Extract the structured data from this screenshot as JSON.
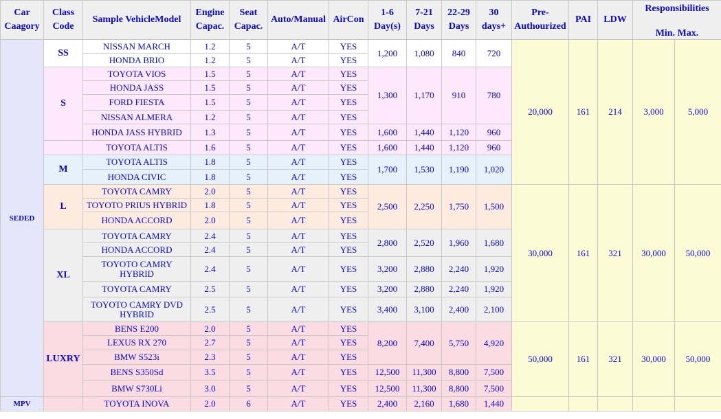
{
  "headers": {
    "car_category": "Car Caagory",
    "class_code": "Class Code",
    "sample_model": "Sample VehicleModel",
    "engine": "Engine Capac.",
    "seat": "Seat Capac.",
    "transmission": "Auto/Manual",
    "aircon": "AirCon",
    "d1_6": "1-6 Day(s)",
    "d7_21": "7-21 Days",
    "d22_29": "22-29 Days",
    "d30": "30 days+",
    "preauth": "Pre-Authourized",
    "pai": "PAI",
    "ldw": "LDW",
    "resp_title": "Responsibilities",
    "resp_minmax": "Min. Max."
  },
  "categories": {
    "sedan": "SEDED",
    "mpv": "MPV"
  },
  "classes": {
    "ss": "SS",
    "s": "S",
    "m": "M",
    "l": "L",
    "xl": "XL",
    "luxury": "LUXRY"
  },
  "rows": [
    {
      "model": "NISSAN MARCH",
      "engine": "1.2",
      "seat": "5",
      "trans": "A/T",
      "aircon": "YES"
    },
    {
      "model": "HONDA BRIO",
      "engine": "1.2",
      "seat": "5",
      "trans": "A/T",
      "aircon": "YES"
    },
    {
      "model": "TOYOTA VIOS",
      "engine": "1.5",
      "seat": "5",
      "trans": "A/T",
      "aircon": "YES"
    },
    {
      "model": "HONDA JASS",
      "engine": "1.5",
      "seat": "5",
      "trans": "A/T",
      "aircon": "YES"
    },
    {
      "model": "FORD FIESTA",
      "engine": "1.5",
      "seat": "5",
      "trans": "A/T",
      "aircon": "YES"
    },
    {
      "model": "NISSAN ALMERA",
      "engine": "1.2",
      "seat": "5",
      "trans": "A/T",
      "aircon": "YES"
    },
    {
      "model": "HONDA JASS HYBRID",
      "engine": "1.3",
      "seat": "5",
      "trans": "A/T",
      "aircon": "YES"
    },
    {
      "model": "TOYOTA ALTIS",
      "engine": "1.6",
      "seat": "5",
      "trans": "A/T",
      "aircon": "YES"
    },
    {
      "model": "TOYOTA ALTIS",
      "engine": "1.8",
      "seat": "5",
      "trans": "A/T",
      "aircon": "YES"
    },
    {
      "model": "HONDA CIVIC",
      "engine": "1.8",
      "seat": "5",
      "trans": "A/T",
      "aircon": "YES"
    },
    {
      "model": "TOYOTA CAMRY",
      "engine": "2.0",
      "seat": "5",
      "trans": "A/T",
      "aircon": "YES"
    },
    {
      "model": "TOYOTO PRIUS HYBRID",
      "engine": "1.8",
      "seat": "5",
      "trans": "A/T",
      "aircon": "YES"
    },
    {
      "model": "HONDA ACCORD",
      "engine": "2.0",
      "seat": "5",
      "trans": "A/T",
      "aircon": "YES"
    },
    {
      "model": "TOYOTA CAMRY",
      "engine": "2.4",
      "seat": "5",
      "trans": "A/T",
      "aircon": "YES"
    },
    {
      "model": "HONDA ACCORD",
      "engine": "2.4",
      "seat": "5",
      "trans": "A/T",
      "aircon": "YES"
    },
    {
      "model": "TOYOTO CAMRY HYBRID",
      "engine": "2.4",
      "seat": "5",
      "trans": "A/T",
      "aircon": "YES"
    },
    {
      "model": "TOYOTA CAMRY",
      "engine": "2.5",
      "seat": "5",
      "trans": "A/T",
      "aircon": "YES"
    },
    {
      "model": "TOYOTO CAMRY DVD HYBRID",
      "engine": "2.5",
      "seat": "5",
      "trans": "A/T",
      "aircon": "YES"
    },
    {
      "model": "BENS E200",
      "engine": "2.0",
      "seat": "5",
      "trans": "A/T",
      "aircon": "YES"
    },
    {
      "model": "LEXUS RX 270",
      "engine": "2.7",
      "seat": "5",
      "trans": "A/T",
      "aircon": "YES"
    },
    {
      "model": "BMW S523i",
      "engine": "2.3",
      "seat": "5",
      "trans": "A/T",
      "aircon": "YES"
    },
    {
      "model": "BENS S350Sd",
      "engine": "3.5",
      "seat": "5",
      "trans": "A/T",
      "aircon": "YES"
    },
    {
      "model": "BMW S730Li",
      "engine": "3.0",
      "seat": "5",
      "trans": "A/T",
      "aircon": "YES"
    },
    {
      "model": "TOYOTA INOVA",
      "engine": "2.0",
      "seat": "6",
      "trans": "A/T",
      "aircon": "YES"
    }
  ],
  "rates": {
    "ss": [
      "1,200",
      "1,080",
      "840",
      "720"
    ],
    "s": [
      "1,300",
      "1,170",
      "910",
      "780"
    ],
    "s_jass": [
      "1,600",
      "1,440",
      "1,120",
      "960"
    ],
    "altis16": [
      "1,600",
      "1,440",
      "1,120",
      "960"
    ],
    "m": [
      "1,700",
      "1,530",
      "1,190",
      "1,020"
    ],
    "l": [
      "2,500",
      "2,250",
      "1,750",
      "1,500"
    ],
    "xl1": [
      "2,800",
      "2,520",
      "1,960",
      "1,680"
    ],
    "xl2": [
      "3,200",
      "2,880",
      "2,240",
      "1,920"
    ],
    "xl3": [
      "3,200",
      "2,880",
      "2,240",
      "1,920"
    ],
    "xl4": [
      "3,400",
      "3,100",
      "2,400",
      "2,100"
    ],
    "lx1": [
      "8,200",
      "7,400",
      "5,750",
      "4,920"
    ],
    "lx2": [
      "12,500",
      "11,300",
      "8,800",
      "7,500"
    ],
    "lx3": [
      "12,500",
      "11,300",
      "8,800",
      "7,500"
    ],
    "mpv": [
      "2,400",
      "2,160",
      "1,680",
      "1,440"
    ]
  },
  "fees": [
    {
      "preauth": "20,000",
      "pai": "161",
      "ldw": "214",
      "min": "3,000",
      "max": "5,000"
    },
    {
      "preauth": "30,000",
      "pai": "161",
      "ldw": "321",
      "min": "30,000",
      "max": "50,000"
    },
    {
      "preauth": "50,000",
      "pai": "161",
      "ldw": "321",
      "min": "30,000",
      "max": "50,000"
    }
  ]
}
